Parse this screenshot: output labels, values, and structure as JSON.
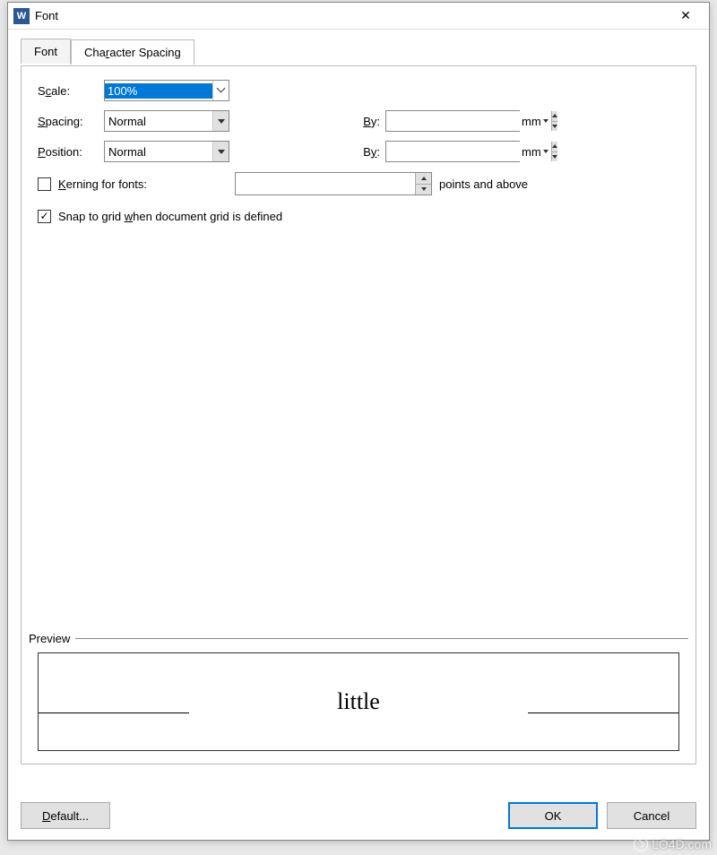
{
  "window": {
    "title": "Font"
  },
  "tabs": {
    "font": "Font",
    "charspacing_pre": "Cha",
    "charspacing_u": "r",
    "charspacing_post": "acter Spacing"
  },
  "labels": {
    "scale_pre": "S",
    "scale_u": "c",
    "scale_post": "ale:",
    "spacing_u": "S",
    "spacing_post": "pacing:",
    "position_u": "P",
    "position_post": "osition:",
    "by1_u": "B",
    "by1_post": "y:",
    "by2_pre": "B",
    "by2_u": "y",
    "by2_post": ":",
    "kerning_u": "K",
    "kerning_post": "erning for fonts:",
    "points_after": "points and above",
    "snap_pre": "Snap to grid ",
    "snap_u": "w",
    "snap_post": "hen document grid is defined",
    "preview": "Preview",
    "mm1": "mm",
    "mm2": "mm"
  },
  "values": {
    "scale": "100%",
    "spacing": "Normal",
    "position": "Normal",
    "by1": "",
    "by2": "",
    "kerning_pts": "",
    "snap_checked": true,
    "kerning_checked": false,
    "preview_text": "little"
  },
  "buttons": {
    "default_u": "D",
    "default_post": "efault...",
    "ok": "OK",
    "cancel": "Cancel"
  },
  "watermark": "LO4D.com"
}
